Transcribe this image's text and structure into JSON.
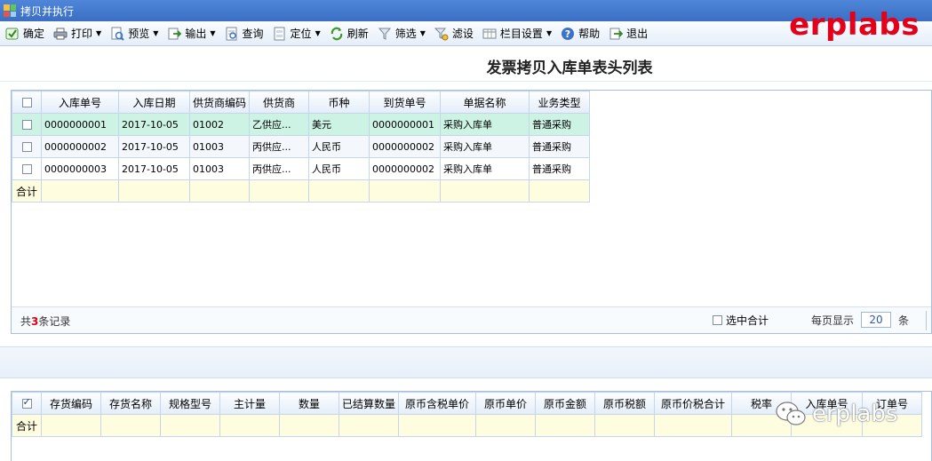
{
  "window": {
    "title": "拷贝并执行"
  },
  "brand": "erplabs",
  "watermark": "erplabs",
  "toolbar": {
    "buttons": [
      {
        "label": "确定",
        "icon": "confirm-check-icon"
      },
      {
        "label": "打印",
        "icon": "printer-icon",
        "dropdown": true
      },
      {
        "label": "预览",
        "icon": "preview-icon",
        "dropdown": true
      },
      {
        "label": "输出",
        "icon": "export-icon",
        "dropdown": true
      },
      {
        "label": "查询",
        "icon": "query-icon"
      },
      {
        "label": "定位",
        "icon": "locate-icon",
        "dropdown": true
      },
      {
        "label": "刷新",
        "icon": "refresh-icon"
      },
      {
        "label": "筛选",
        "icon": "filter-icon",
        "dropdown": true
      },
      {
        "label": "滤设",
        "icon": "filter-settings-icon"
      },
      {
        "label": "栏目设置",
        "icon": "column-settings-icon",
        "dropdown": true
      },
      {
        "label": "帮助",
        "icon": "help-icon"
      },
      {
        "label": "退出",
        "icon": "exit-icon"
      }
    ]
  },
  "page_title": "发票拷贝入库单表头列表",
  "header_grid": {
    "columns": [
      "入库单号",
      "入库日期",
      "供货商编码",
      "供货商",
      "币种",
      "到货单号",
      "单据名称",
      "业务类型"
    ],
    "rows": [
      [
        "0000000001",
        "2017-10-05",
        "01002",
        "乙供应...",
        "美元",
        "0000000001",
        "采购入库单",
        "普通采购"
      ],
      [
        "0000000002",
        "2017-10-05",
        "01003",
        "丙供应...",
        "人民币",
        "0000000002",
        "采购入库单",
        "普通采购"
      ],
      [
        "0000000003",
        "2017-10-05",
        "01003",
        "丙供应...",
        "人民币",
        "0000000002",
        "采购入库单",
        "普通采购"
      ]
    ],
    "total_label": "合计"
  },
  "footer": {
    "count_prefix": "共",
    "count_value": "3",
    "count_suffix": "条记录",
    "select_sum_label": "选中合计",
    "page_size_label": "每页显示",
    "page_size_value": "20",
    "page_size_unit": "条"
  },
  "detail_grid": {
    "columns": [
      "存货编码",
      "存货名称",
      "规格型号",
      "主计量",
      "数量",
      "已结算数量",
      "原币含税单价",
      "原币单价",
      "原币金额",
      "原币税额",
      "原币价税合计",
      "税率",
      "入库单号",
      "订单号"
    ],
    "total_label": "合计"
  },
  "colors": {
    "brand": "#e2001a",
    "selected_row": "#cdf3e5",
    "total_row": "#fffde0",
    "titlebar": "#3a6fc4"
  }
}
